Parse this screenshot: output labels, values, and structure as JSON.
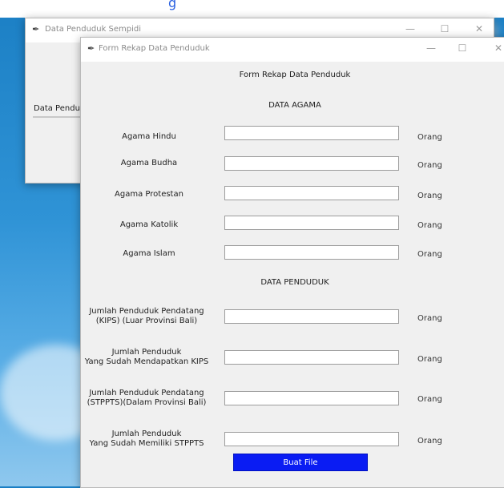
{
  "background": {
    "top_link": "g"
  },
  "back_window": {
    "title": "Data Penduduk Sempidi",
    "menu_label": "Data Pendu",
    "controls": {
      "minimize": "—",
      "maximize": "☐",
      "close": "✕"
    }
  },
  "form_window": {
    "title": "Form Rekap Data Penduduk",
    "controls": {
      "minimize": "—",
      "maximize": "☐",
      "close": "✕"
    },
    "heading": "Form Rekap Data Penduduk",
    "section_agama": "DATA AGAMA",
    "section_penduduk": "DATA PENDUDUK",
    "unit": "Orang",
    "agama_rows": [
      {
        "label": "Agama Hindu"
      },
      {
        "label": "Agama Budha"
      },
      {
        "label": "Agama Protestan"
      },
      {
        "label": "Agama Katolik"
      },
      {
        "label": "Agama Islam"
      }
    ],
    "penduduk_rows": [
      {
        "line1": "Jumlah Penduduk Pendatang",
        "line2": "(KIPS) (Luar Provinsi Bali)"
      },
      {
        "line1": "Jumlah Penduduk",
        "line2": "Yang Sudah Mendapatkan KIPS"
      },
      {
        "line1": "Jumlah Penduduk Pendatang",
        "line2": "(STPPTS)(Dalam Provinsi Bali)"
      },
      {
        "line1": "Jumlah Penduduk",
        "line2": "Yang Sudah Memiliki STPPTS"
      }
    ],
    "submit_label": "Buat File"
  },
  "colors": {
    "button": "#0a1cf3",
    "window_bg": "#f0f0f0",
    "desktop": "#2f93d6"
  }
}
